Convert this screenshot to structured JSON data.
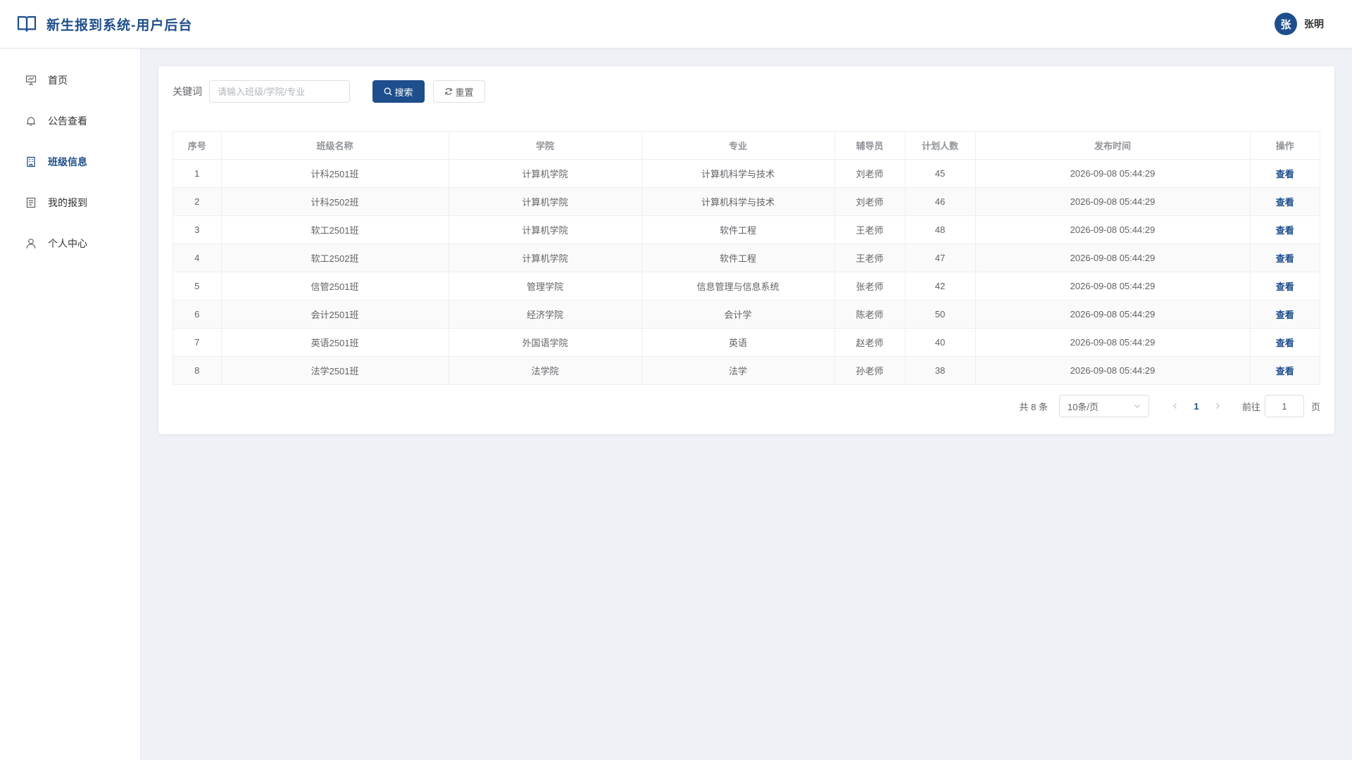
{
  "header": {
    "title": "新生报到系统-用户后台"
  },
  "user": {
    "avatar_text": "张",
    "name": "张明"
  },
  "sidebar": {
    "items": [
      {
        "label": "首页",
        "icon": "presentation-board-icon"
      },
      {
        "label": "公告查看",
        "icon": "bell-icon"
      },
      {
        "label": "班级信息",
        "icon": "building-icon",
        "active": true
      },
      {
        "label": "我的报到",
        "icon": "document-icon"
      },
      {
        "label": "个人中心",
        "icon": "user-icon"
      }
    ]
  },
  "search": {
    "label": "关键词",
    "placeholder": "请输入班级/学院/专业",
    "search_button": "搜索",
    "reset_button": "重置"
  },
  "table": {
    "headers": [
      "序号",
      "班级名称",
      "学院",
      "专业",
      "辅导员",
      "计划人数",
      "发布时间",
      "操作"
    ],
    "rows": [
      [
        "1",
        "计科2501班",
        "计算机学院",
        "计算机科学与技术",
        "刘老师",
        "45",
        "2026-09-08 05:44:29",
        "查看"
      ],
      [
        "2",
        "计科2502班",
        "计算机学院",
        "计算机科学与技术",
        "刘老师",
        "46",
        "2026-09-08 05:44:29",
        "查看"
      ],
      [
        "3",
        "软工2501班",
        "计算机学院",
        "软件工程",
        "王老师",
        "48",
        "2026-09-08 05:44:29",
        "查看"
      ],
      [
        "4",
        "软工2502班",
        "计算机学院",
        "软件工程",
        "王老师",
        "47",
        "2026-09-08 05:44:29",
        "查看"
      ],
      [
        "5",
        "信管2501班",
        "管理学院",
        "信息管理与信息系统",
        "张老师",
        "42",
        "2026-09-08 05:44:29",
        "查看"
      ],
      [
        "6",
        "会计2501班",
        "经济学院",
        "会计学",
        "陈老师",
        "50",
        "2026-09-08 05:44:29",
        "查看"
      ],
      [
        "7",
        "英语2501班",
        "外国语学院",
        "英语",
        "赵老师",
        "40",
        "2026-09-08 05:44:29",
        "查看"
      ],
      [
        "8",
        "法学2501班",
        "法学院",
        "法学",
        "孙老师",
        "38",
        "2026-09-08 05:44:29",
        "查看"
      ]
    ]
  },
  "pagination": {
    "total_text": "共 8 条",
    "page_size": "10条/页",
    "current_page": "1",
    "goto_label": "前往",
    "goto_value": "1",
    "page_unit": "页"
  },
  "colors": {
    "primary": "#1e4e8c",
    "background": "#eef1f6"
  }
}
